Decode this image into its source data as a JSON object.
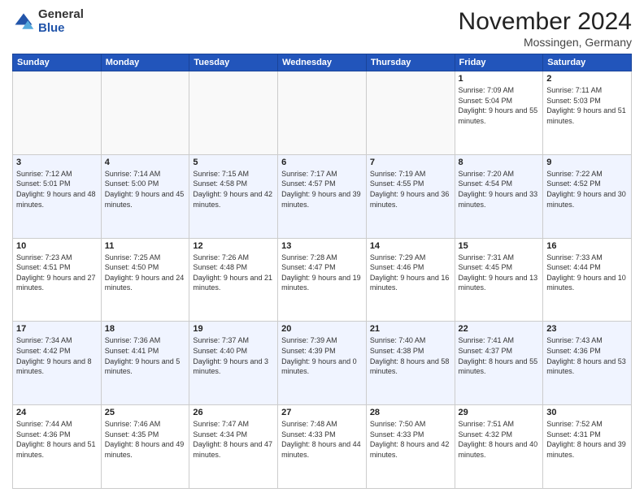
{
  "logo": {
    "general": "General",
    "blue": "Blue"
  },
  "header": {
    "title": "November 2024",
    "location": "Mossingen, Germany"
  },
  "weekdays": [
    "Sunday",
    "Monday",
    "Tuesday",
    "Wednesday",
    "Thursday",
    "Friday",
    "Saturday"
  ],
  "weeks": [
    [
      {
        "day": "",
        "info": ""
      },
      {
        "day": "",
        "info": ""
      },
      {
        "day": "",
        "info": ""
      },
      {
        "day": "",
        "info": ""
      },
      {
        "day": "",
        "info": ""
      },
      {
        "day": "1",
        "info": "Sunrise: 7:09 AM\nSunset: 5:04 PM\nDaylight: 9 hours and 55 minutes."
      },
      {
        "day": "2",
        "info": "Sunrise: 7:11 AM\nSunset: 5:03 PM\nDaylight: 9 hours and 51 minutes."
      }
    ],
    [
      {
        "day": "3",
        "info": "Sunrise: 7:12 AM\nSunset: 5:01 PM\nDaylight: 9 hours and 48 minutes."
      },
      {
        "day": "4",
        "info": "Sunrise: 7:14 AM\nSunset: 5:00 PM\nDaylight: 9 hours and 45 minutes."
      },
      {
        "day": "5",
        "info": "Sunrise: 7:15 AM\nSunset: 4:58 PM\nDaylight: 9 hours and 42 minutes."
      },
      {
        "day": "6",
        "info": "Sunrise: 7:17 AM\nSunset: 4:57 PM\nDaylight: 9 hours and 39 minutes."
      },
      {
        "day": "7",
        "info": "Sunrise: 7:19 AM\nSunset: 4:55 PM\nDaylight: 9 hours and 36 minutes."
      },
      {
        "day": "8",
        "info": "Sunrise: 7:20 AM\nSunset: 4:54 PM\nDaylight: 9 hours and 33 minutes."
      },
      {
        "day": "9",
        "info": "Sunrise: 7:22 AM\nSunset: 4:52 PM\nDaylight: 9 hours and 30 minutes."
      }
    ],
    [
      {
        "day": "10",
        "info": "Sunrise: 7:23 AM\nSunset: 4:51 PM\nDaylight: 9 hours and 27 minutes."
      },
      {
        "day": "11",
        "info": "Sunrise: 7:25 AM\nSunset: 4:50 PM\nDaylight: 9 hours and 24 minutes."
      },
      {
        "day": "12",
        "info": "Sunrise: 7:26 AM\nSunset: 4:48 PM\nDaylight: 9 hours and 21 minutes."
      },
      {
        "day": "13",
        "info": "Sunrise: 7:28 AM\nSunset: 4:47 PM\nDaylight: 9 hours and 19 minutes."
      },
      {
        "day": "14",
        "info": "Sunrise: 7:29 AM\nSunset: 4:46 PM\nDaylight: 9 hours and 16 minutes."
      },
      {
        "day": "15",
        "info": "Sunrise: 7:31 AM\nSunset: 4:45 PM\nDaylight: 9 hours and 13 minutes."
      },
      {
        "day": "16",
        "info": "Sunrise: 7:33 AM\nSunset: 4:44 PM\nDaylight: 9 hours and 10 minutes."
      }
    ],
    [
      {
        "day": "17",
        "info": "Sunrise: 7:34 AM\nSunset: 4:42 PM\nDaylight: 9 hours and 8 minutes."
      },
      {
        "day": "18",
        "info": "Sunrise: 7:36 AM\nSunset: 4:41 PM\nDaylight: 9 hours and 5 minutes."
      },
      {
        "day": "19",
        "info": "Sunrise: 7:37 AM\nSunset: 4:40 PM\nDaylight: 9 hours and 3 minutes."
      },
      {
        "day": "20",
        "info": "Sunrise: 7:39 AM\nSunset: 4:39 PM\nDaylight: 9 hours and 0 minutes."
      },
      {
        "day": "21",
        "info": "Sunrise: 7:40 AM\nSunset: 4:38 PM\nDaylight: 8 hours and 58 minutes."
      },
      {
        "day": "22",
        "info": "Sunrise: 7:41 AM\nSunset: 4:37 PM\nDaylight: 8 hours and 55 minutes."
      },
      {
        "day": "23",
        "info": "Sunrise: 7:43 AM\nSunset: 4:36 PM\nDaylight: 8 hours and 53 minutes."
      }
    ],
    [
      {
        "day": "24",
        "info": "Sunrise: 7:44 AM\nSunset: 4:36 PM\nDaylight: 8 hours and 51 minutes."
      },
      {
        "day": "25",
        "info": "Sunrise: 7:46 AM\nSunset: 4:35 PM\nDaylight: 8 hours and 49 minutes."
      },
      {
        "day": "26",
        "info": "Sunrise: 7:47 AM\nSunset: 4:34 PM\nDaylight: 8 hours and 47 minutes."
      },
      {
        "day": "27",
        "info": "Sunrise: 7:48 AM\nSunset: 4:33 PM\nDaylight: 8 hours and 44 minutes."
      },
      {
        "day": "28",
        "info": "Sunrise: 7:50 AM\nSunset: 4:33 PM\nDaylight: 8 hours and 42 minutes."
      },
      {
        "day": "29",
        "info": "Sunrise: 7:51 AM\nSunset: 4:32 PM\nDaylight: 8 hours and 40 minutes."
      },
      {
        "day": "30",
        "info": "Sunrise: 7:52 AM\nSunset: 4:31 PM\nDaylight: 8 hours and 39 minutes."
      }
    ]
  ]
}
